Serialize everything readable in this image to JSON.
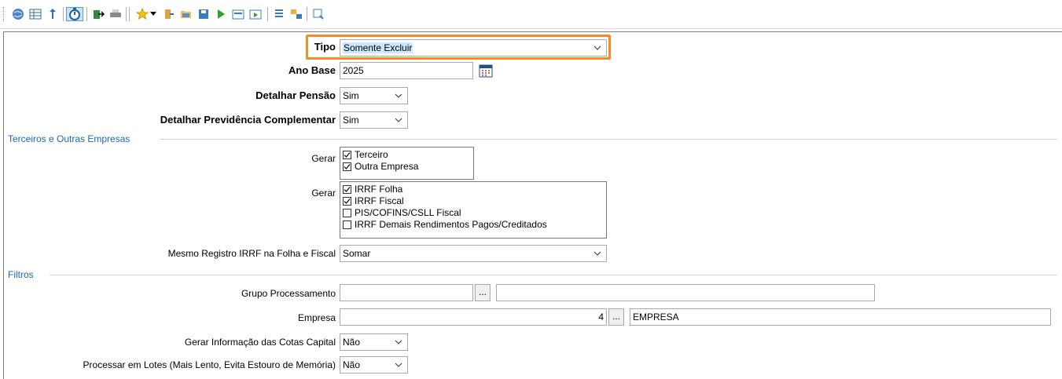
{
  "toolbar": {
    "icons": [
      "globe-icon",
      "grid-icon",
      "info-icon",
      "stopwatch-icon",
      "export-icon",
      "print-icon",
      "star-icon",
      "dropdown-icon",
      "exit-icon",
      "folder-open-icon",
      "save-icon",
      "play-icon",
      "form-icon",
      "form-exec-icon",
      "list-icon",
      "transfer-icon",
      "zoom-icon"
    ]
  },
  "form": {
    "tipo": {
      "label": "Tipo",
      "value": "Somente Excluir"
    },
    "ano_base": {
      "label": "Ano Base",
      "value": "2025"
    },
    "detalhar_pensao": {
      "label": "Detalhar Pensão",
      "value": "Sim"
    },
    "detalhar_previdencia": {
      "label": "Detalhar Previdência Complementar",
      "value": "Sim"
    }
  },
  "terceiros": {
    "title": "Terceiros e Outras Empresas",
    "gerar1": {
      "label": "Gerar",
      "options": [
        {
          "label": "Terceiro",
          "checked": true
        },
        {
          "label": "Outra Empresa",
          "checked": true
        }
      ]
    },
    "gerar2": {
      "label": "Gerar",
      "options": [
        {
          "label": "IRRF Folha",
          "checked": true
        },
        {
          "label": "IRRF Fiscal",
          "checked": true
        },
        {
          "label": "PIS/COFINS/CSLL Fiscal",
          "checked": false
        },
        {
          "label": "IRRF Demais Rendimentos Pagos/Creditados",
          "checked": false
        }
      ]
    },
    "mesmo_registro": {
      "label": "Mesmo Registro IRRF na Folha e Fiscal",
      "value": "Somar"
    }
  },
  "filtros": {
    "title": "Filtros",
    "grupo": {
      "label": "Grupo Processamento",
      "code": "",
      "desc": "",
      "button": "..."
    },
    "empresa": {
      "label": "Empresa",
      "code": "4",
      "desc": "EMPRESA",
      "button": "..."
    },
    "cotas": {
      "label": "Gerar Informação das Cotas Capital",
      "value": "Não"
    },
    "lotes": {
      "label": "Processar em Lotes (Mais Lento, Evita Estouro de Memória)",
      "value": "Não"
    }
  },
  "colors": {
    "highlight": "#f28c28",
    "section": "#1e66b7",
    "selection": "#cce8ff"
  }
}
